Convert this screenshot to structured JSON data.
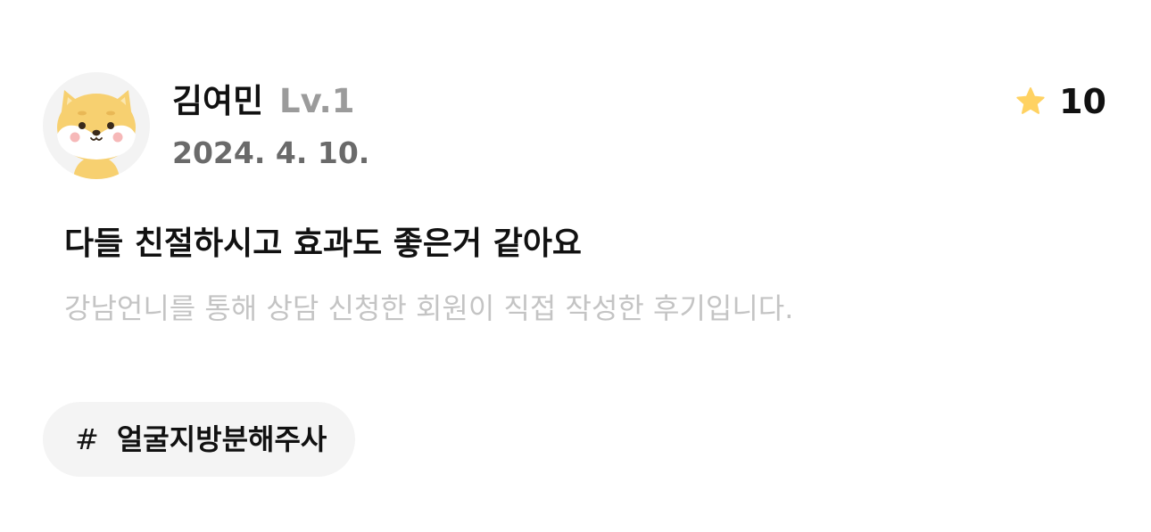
{
  "review": {
    "author": {
      "name": "김여민",
      "level": "Lv.1",
      "avatar_icon": "shiba-dog-avatar-icon"
    },
    "date": "2024. 4. 10.",
    "points": {
      "icon": "star-icon",
      "value": "10"
    },
    "title": "다들 친절하시고 효과도 좋은거 같아요",
    "notice": "강남언니를 통해 상담 신청한 회원이 직접 작성한 후기입니다.",
    "tags": [
      {
        "hash": "#",
        "label": "얼굴지방분해주사"
      }
    ]
  },
  "colors": {
    "background": "#ffffff",
    "text_primary": "#111111",
    "text_level": "#9b9b9b",
    "text_date": "#6a6a6a",
    "text_notice": "#c4c4c4",
    "star": "#ffd262",
    "chip_bg": "#f4f4f4",
    "avatar_bg": "#f3f3f3"
  }
}
